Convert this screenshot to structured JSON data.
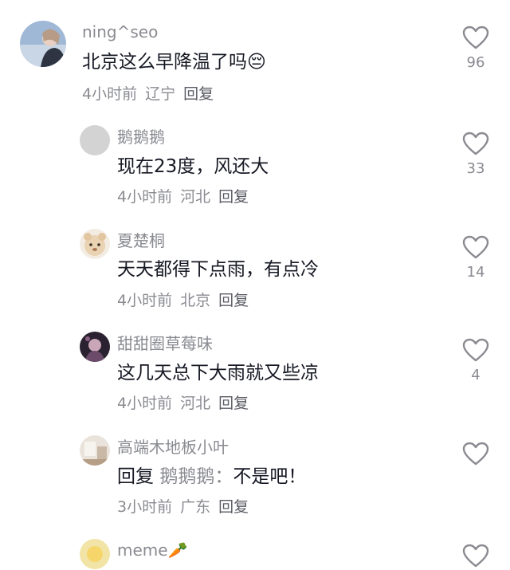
{
  "comments": [
    {
      "username": "ning^seo",
      "text": "北京这么早降温了吗",
      "emoji": "😔",
      "time": "4小时前",
      "location": "辽宁",
      "reply_label": "回复",
      "likes": "96"
    },
    {
      "username": "鹅鹅鹅",
      "text": "现在23度，风还大",
      "time": "4小时前",
      "location": "河北",
      "reply_label": "回复",
      "likes": "33"
    },
    {
      "username": "夏楚桐",
      "text": "天天都得下点雨，有点冷",
      "time": "4小时前",
      "location": "北京",
      "reply_label": "回复",
      "likes": "14"
    },
    {
      "username": "甜甜圈草莓味",
      "text": "这几天总下大雨就又些凉",
      "time": "4小时前",
      "location": "河北",
      "reply_label": "回复",
      "likes": "4"
    },
    {
      "username": "高端木地板小叶",
      "reply_prefix": "回复",
      "mention": "鹅鹅鹅：",
      "text": "不是吧！",
      "time": "3小时前",
      "location": "广东",
      "reply_label": "回复",
      "likes": ""
    },
    {
      "username": "meme",
      "emoji": "🥕"
    }
  ]
}
